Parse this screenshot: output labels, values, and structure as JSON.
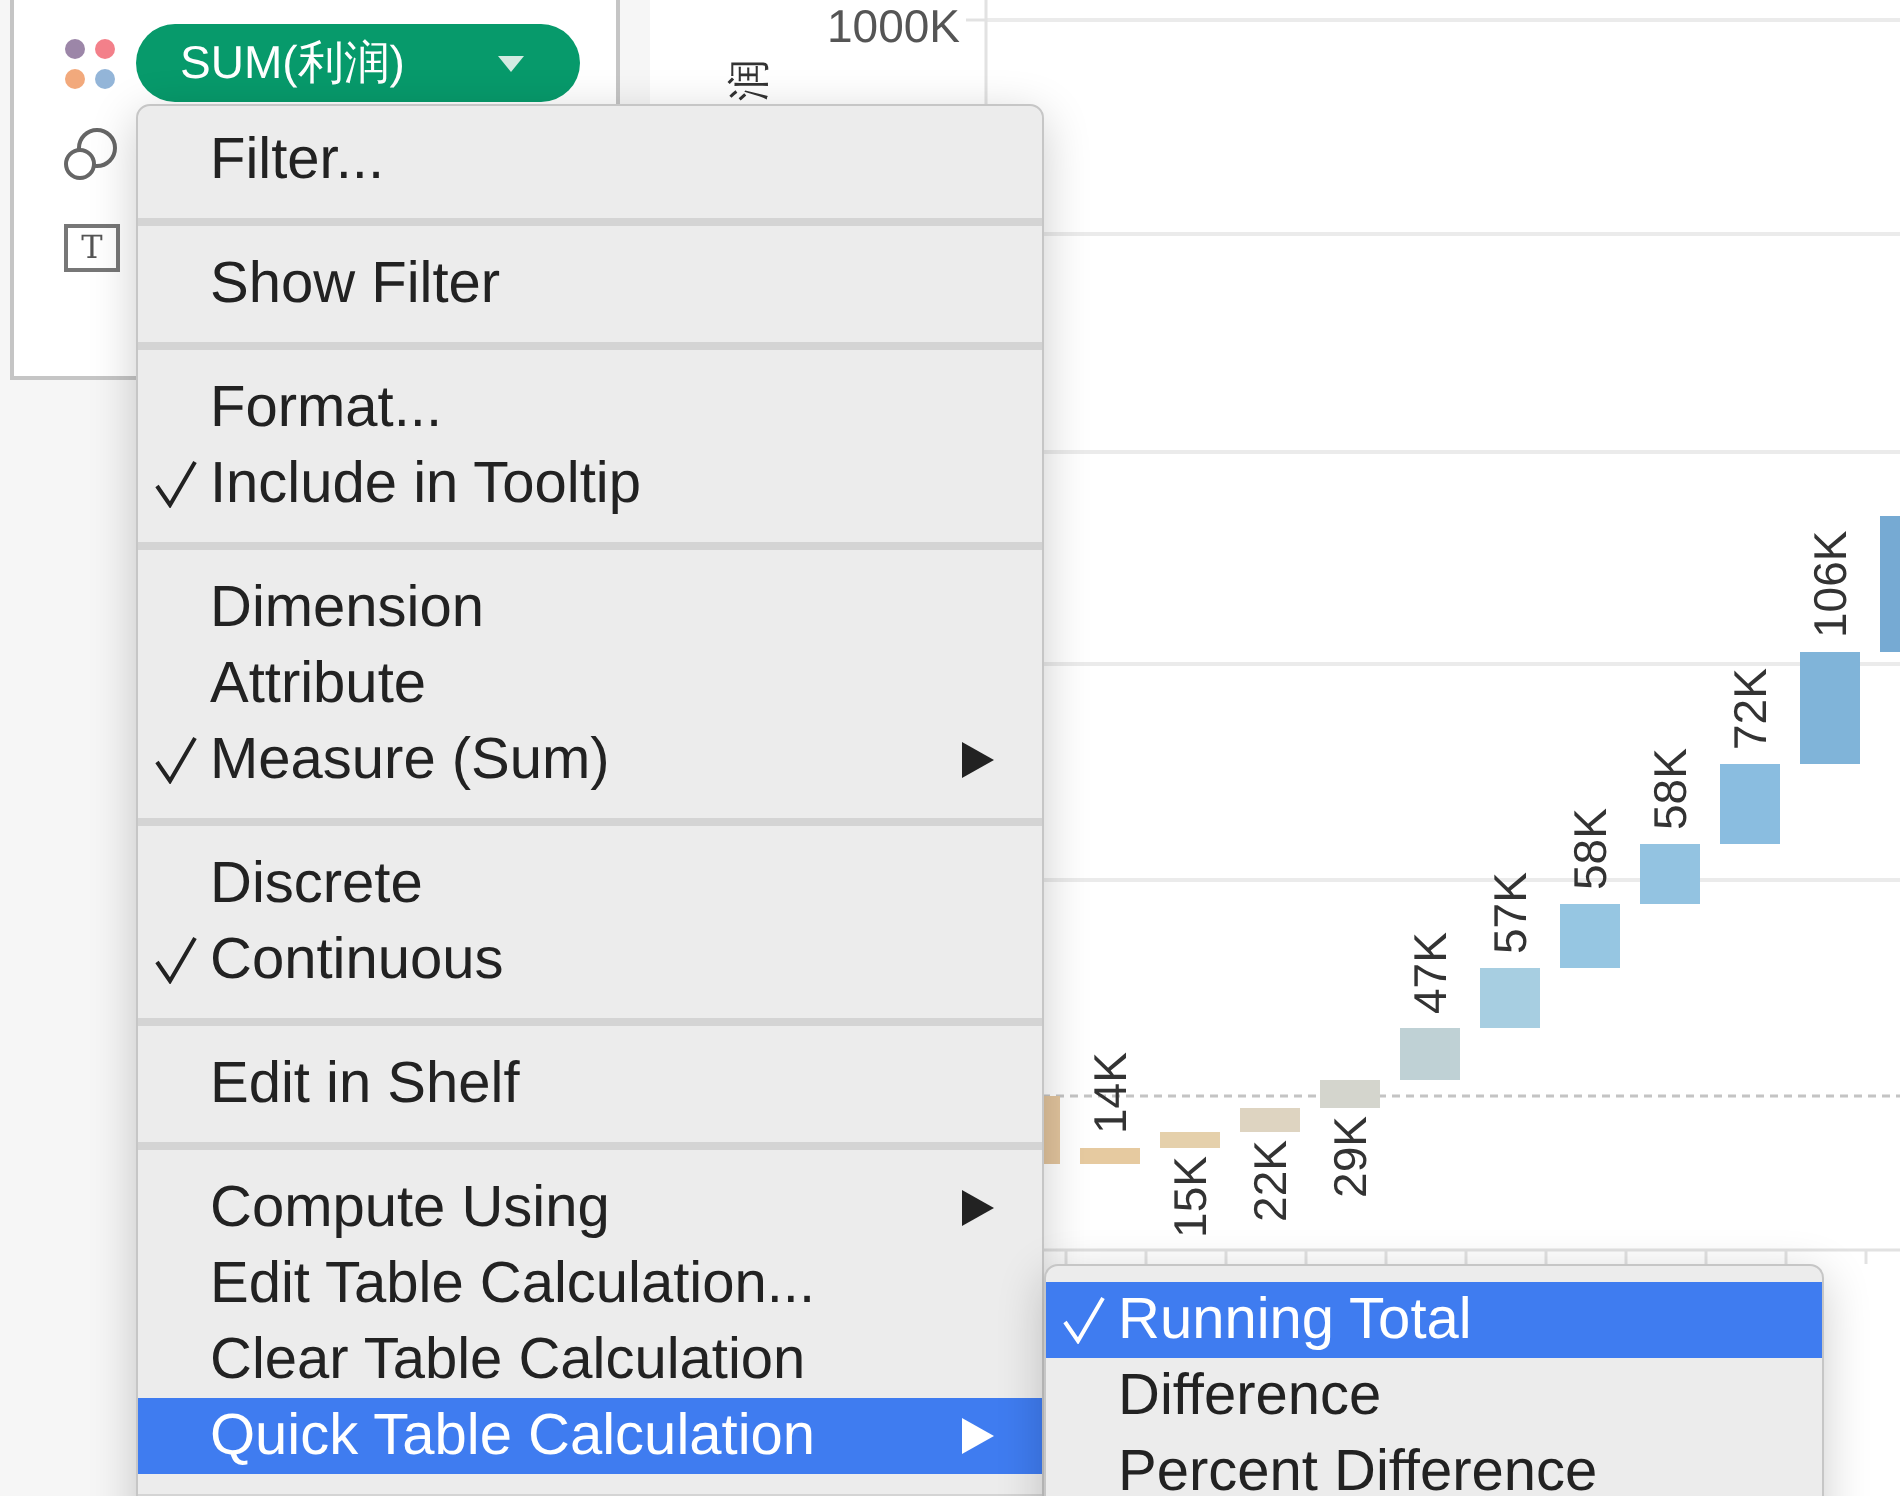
{
  "marks_card": {
    "field_pill": {
      "label": "SUM(利润)"
    },
    "text_icon_letter": "T"
  },
  "chart": {
    "y_axis": {
      "title": "润",
      "tick": "1000K"
    },
    "bars": [
      {
        "color": "#e2c49d"
      },
      {
        "label": "14K",
        "color": "#e6caa0"
      },
      {
        "label": "15K",
        "color": "#e5d0ab"
      },
      {
        "label": "22K",
        "color": "#ded4c1"
      },
      {
        "label": "29K",
        "color": "#d4d5cd"
      },
      {
        "label": "47K",
        "color": "#bfd1d5"
      },
      {
        "label": "57K",
        "color": "#a7cee1"
      },
      {
        "label": "58K",
        "color": "#96c6e2"
      },
      {
        "label": "58K",
        "color": "#93c3e1"
      },
      {
        "label": "72K",
        "color": "#8abde0"
      },
      {
        "label": "106K",
        "color": "#80b4d9"
      },
      {
        "color": "#76aad3"
      }
    ]
  },
  "context_menu": {
    "items": [
      {
        "kind": "item",
        "label": "Filter...",
        "checked": false,
        "selected": false,
        "submenu": false
      },
      {
        "kind": "separator"
      },
      {
        "kind": "item",
        "label": "Show Filter",
        "checked": false,
        "selected": false,
        "submenu": false
      },
      {
        "kind": "separator"
      },
      {
        "kind": "item",
        "label": "Format...",
        "checked": false,
        "selected": false,
        "submenu": false
      },
      {
        "kind": "item",
        "label": "Include in Tooltip",
        "checked": true,
        "selected": false,
        "submenu": false
      },
      {
        "kind": "separator"
      },
      {
        "kind": "item",
        "label": "Dimension",
        "checked": false,
        "selected": false,
        "submenu": false
      },
      {
        "kind": "item",
        "label": "Attribute",
        "checked": false,
        "selected": false,
        "submenu": false
      },
      {
        "kind": "item",
        "label": "Measure (Sum)",
        "checked": true,
        "selected": false,
        "submenu": true
      },
      {
        "kind": "separator"
      },
      {
        "kind": "item",
        "label": "Discrete",
        "checked": false,
        "selected": false,
        "submenu": false
      },
      {
        "kind": "item",
        "label": "Continuous",
        "checked": true,
        "selected": false,
        "submenu": false
      },
      {
        "kind": "separator"
      },
      {
        "kind": "item",
        "label": "Edit in Shelf",
        "checked": false,
        "selected": false,
        "submenu": false
      },
      {
        "kind": "separator"
      },
      {
        "kind": "item",
        "label": "Compute Using",
        "checked": false,
        "selected": false,
        "submenu": true
      },
      {
        "kind": "item",
        "label": "Edit Table Calculation...",
        "checked": false,
        "selected": false,
        "submenu": false
      },
      {
        "kind": "item",
        "label": "Clear Table Calculation",
        "checked": false,
        "selected": false,
        "submenu": false
      },
      {
        "kind": "item",
        "label": "Quick Table Calculation",
        "checked": false,
        "selected": true,
        "submenu": true
      },
      {
        "kind": "separator"
      }
    ]
  },
  "submenu": {
    "items": [
      {
        "kind": "item",
        "label": "Running Total",
        "checked": true,
        "selected": true,
        "submenu": false
      },
      {
        "kind": "item",
        "label": "Difference",
        "checked": false,
        "selected": false,
        "submenu": false
      },
      {
        "kind": "item",
        "label": "Percent Difference",
        "checked": false,
        "selected": false,
        "submenu": false
      }
    ]
  }
}
